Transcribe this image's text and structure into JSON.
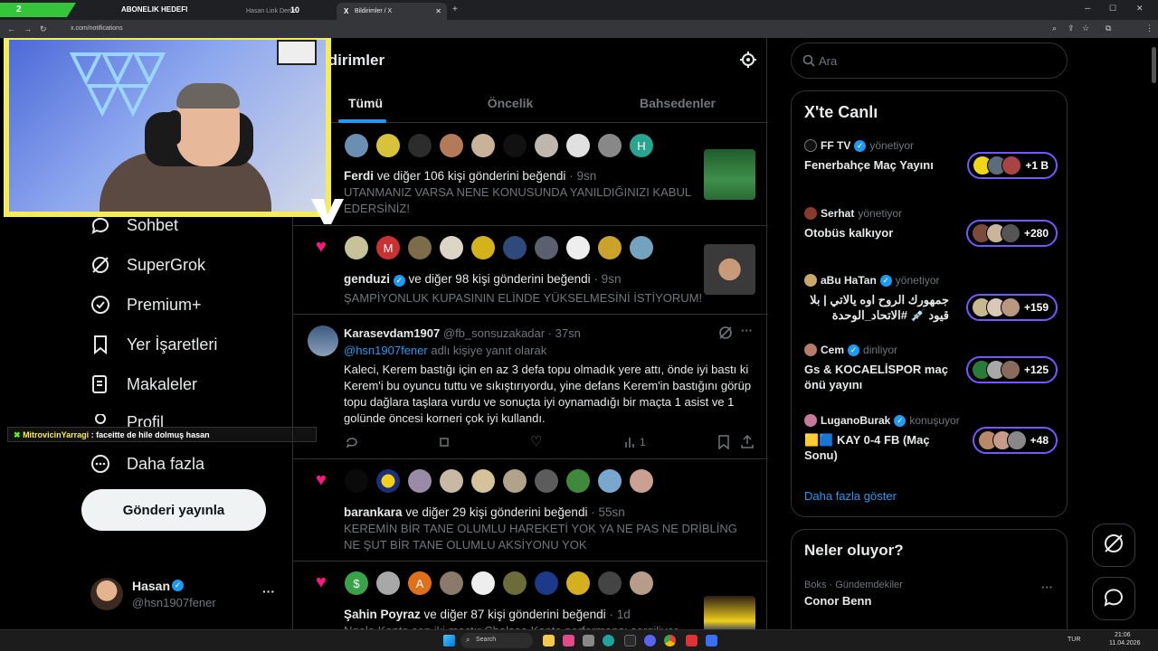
{
  "browser": {
    "tabs": [
      {
        "label": "ABONELIK HEDEFI"
      },
      {
        "label": "Hasan Link Deme"
      },
      {
        "label": "Bildirimler / X"
      }
    ],
    "url": "x.com/notifications",
    "new_tab": "+"
  },
  "overlay": {
    "goal_count": "2",
    "goal_label": "ABONELIK HEDEFI",
    "goal_target": "10",
    "chat_user": "MitrovicinYarragi",
    "chat_message": ": faceitte de hile dolmuş hasan"
  },
  "sidebar": {
    "items": [
      {
        "label": "Sohbet",
        "icon": "chat-bubble-icon"
      },
      {
        "label": "SuperGrok",
        "icon": "grok-icon"
      },
      {
        "label": "Premium+",
        "icon": "premium-badge-icon"
      },
      {
        "label": "Yer İşaretleri",
        "icon": "bookmark-icon"
      },
      {
        "label": "Makaleler",
        "icon": "article-icon"
      },
      {
        "label": "Profil",
        "icon": "profile-icon"
      },
      {
        "label": "Daha fazla",
        "icon": "more-circle-icon"
      }
    ],
    "post_button": "Gönderi yayınla",
    "account": {
      "name": "Hasan",
      "handle": "@hsn1907fener",
      "more": "···"
    }
  },
  "main": {
    "title": "ldirimler",
    "tabs": [
      {
        "label": "Tümü",
        "active": true
      },
      {
        "label": "Öncelik",
        "active": false
      },
      {
        "label": "Bahsedenler",
        "active": false
      }
    ],
    "notifications": [
      {
        "actor": "Ferdi",
        "action": "ve diğer 106 kişi gönderini beğendi",
        "time": "· 9sn",
        "text": "UTANMANIZ VARSA NENE KONUSUNDA YANILDIĞINIZI KABUL EDERSİNİZ!",
        "avatar_letter": "H"
      },
      {
        "actor": "genduzi",
        "action": "ve diğer 98 kişi gönderini beğendi",
        "time": "· 9sn",
        "text": "ŞAMPİYONLUK KUPASININ ELİNDE YÜKSELMESİNİ İSTİYORUM!",
        "avatar_letter": "M"
      },
      {
        "actor": "barankara",
        "action": "ve diğer 29 kişi gönderini beğendi",
        "time": "· 55sn",
        "text": "KEREMİN BİR TANE OLUMLU HAREKETİ YOK YA NE PAS NE DRİBLİNG NE ŞUT BİR TANE OLUMLU AKSİYONU YOK"
      },
      {
        "actor": "Şahin Poyraz",
        "action": "ve diğer 87 kişi gönderini beğendi",
        "time": "· 1d",
        "text": "Ngolo Kante son iki maçtır Chelsea Kante performansı sergiliyor",
        "avatar_letters": [
          "$",
          "A"
        ]
      }
    ],
    "reply": {
      "name": "Karasevdam1907",
      "handle": "@fb_sonsuzakadar",
      "time": "· 37sn",
      "reply_to": "@hsn1907fener",
      "reply_suffix": "adlı kişiye yanıt olarak",
      "text": "Kaleci, Kerem bastığı için en az 3 defa topu olmadık yere attı, önde iyi bastı ki Kerem'i bu oyuncu tuttu ve sıkıştırıyordu, yine defans Kerem'in bastığını görüp topu dağlara taşlara vurdu ve sonuçta iyi oynamadığı bir maçta 1 asist ve 1 golünde öncesi korneri çok iyi kullandı.",
      "views": "1",
      "more": "···"
    }
  },
  "right": {
    "search_placeholder": "Ara",
    "live_title": "X'te Canlı",
    "live_items": [
      {
        "host": "FF TV",
        "role": "yönetiyor",
        "title": "Fenerbahçe Maç Yayını",
        "count": "+1 B"
      },
      {
        "host": "Serhat",
        "role": "yönetiyor",
        "title": "Otobüs kalkıyor",
        "count": "+280"
      },
      {
        "host": "aBu HaTan",
        "role": "yönetiyor",
        "title": "جمهورك الروح اوه يالاتي | بلا قيود 💉 #الاتحاد_الوحدة",
        "count": "+159"
      },
      {
        "host": "Cem",
        "role": "dinliyor",
        "title": "Gs & KOCAELİSPOR maç önü yayını",
        "count": "+125"
      },
      {
        "host": "LuganoBurak",
        "role": "konuşuyor",
        "title": "🟨🟦 KAY 0-4 FB (Maç Sonu)",
        "count": "+48"
      }
    ],
    "show_more": "Daha fazla göster",
    "whats_happening": "Neler oluyor?",
    "trend_category": "Boks · Gündemdekiler",
    "trend_name": "Conor Benn",
    "trend_more": "···"
  },
  "taskbar": {
    "search": "Search",
    "lang": "TUR",
    "time": "21:06",
    "date": "11.04.2026"
  },
  "colors": {
    "accent": "#1d9bf0",
    "heart": "#f91880",
    "live_ring": "#7856ff",
    "overlay_yellow": "#f5ec5b",
    "goal_green": "#35c53a"
  }
}
